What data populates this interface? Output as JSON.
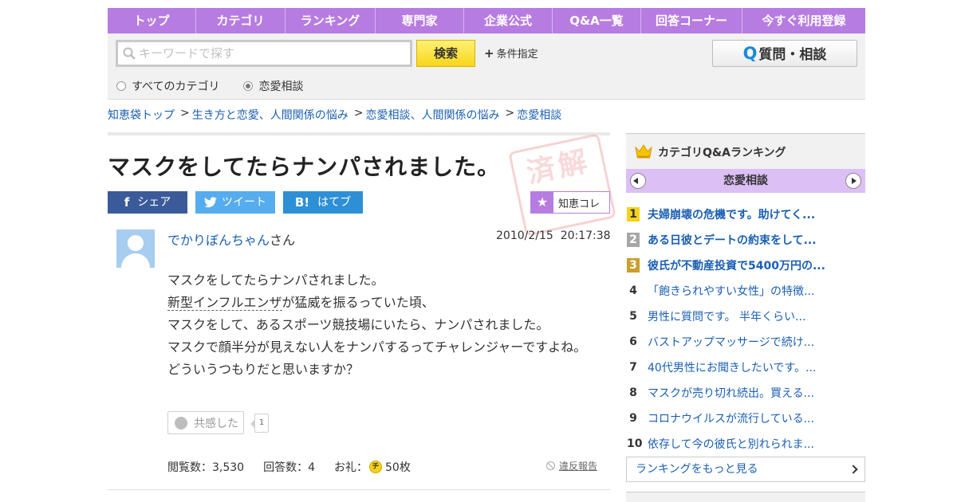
{
  "nav": {
    "items": [
      "トップ",
      "カテゴリ",
      "ランキング",
      "専門家",
      "企業公式",
      "Q&A一覧",
      "回答コーナー",
      "今すぐ利用登録"
    ]
  },
  "search": {
    "placeholder": "キーワードで探す",
    "button": "検索",
    "condition": "条件指定",
    "ask_button": "質問・相談",
    "radios": [
      {
        "label": "すべてのカテゴリ",
        "checked": false
      },
      {
        "label": "恋愛相談",
        "checked": true
      }
    ]
  },
  "breadcrumb": [
    "知恵袋トップ",
    "生き方と恋愛、人間関係の悩み",
    "恋愛相談、人間関係の悩み",
    "恋愛相談"
  ],
  "question": {
    "title": "マスクをしてたらナンパされました。",
    "stamp": "済解",
    "share": {
      "facebook": "シェア",
      "twitter": "ツイート",
      "hatena": "はてブ"
    },
    "chiecolle": "知恵コレ",
    "user": "でかりぼんちゃん",
    "user_suffix": "さん",
    "date": "2010/2/15",
    "time": "20:17:38",
    "body": [
      "マスクをしてたらナンパされました。",
      "新型インフルエンザ",
      "が猛威を振るっていた頃、",
      "マスクをして、あるスポーツ競技場にいたら、ナンパされました。",
      "マスクで顔半分が見えない人をナンパするってチャレンジャーですよね。",
      "どういうつもりだと思いますか？"
    ],
    "kyokan_label": "共感した",
    "kyokan_count": "1",
    "views_label": "閲覧数：3,530",
    "answers_label": "回答数：4",
    "reward_label": "お礼：",
    "coin": "チ",
    "reward_value": "50枚",
    "report": "違反報告"
  },
  "sidebar": {
    "title": "カテゴリQ&Aランキング",
    "category": "恋愛相談",
    "ranking": [
      {
        "rank": "1",
        "text": "夫婦崩壊の危機です。助けてく..."
      },
      {
        "rank": "2",
        "text": "ある日彼とデートの約束をして..."
      },
      {
        "rank": "3",
        "text": "彼氏が不動産投資で5400万円の..."
      },
      {
        "rank": "4",
        "text": "「飽きられやすい女性」の特徴..."
      },
      {
        "rank": "5",
        "text": "男性に質問です。 半年くらい..."
      },
      {
        "rank": "6",
        "text": "バストアップマッサージで続け..."
      },
      {
        "rank": "7",
        "text": "40代男性にお聞きしたいです。..."
      },
      {
        "rank": "8",
        "text": "マスクが売り切れ続出。買える..."
      },
      {
        "rank": "9",
        "text": "コロナウイルスが流行している..."
      },
      {
        "rank": "10",
        "text": "依存して今の彼氏と別れられま..."
      }
    ],
    "more": "ランキングをもっと見る"
  },
  "colors": {
    "accent": "#b77ce1",
    "link": "#1a5fb4",
    "search_button": "#f7d61b"
  }
}
